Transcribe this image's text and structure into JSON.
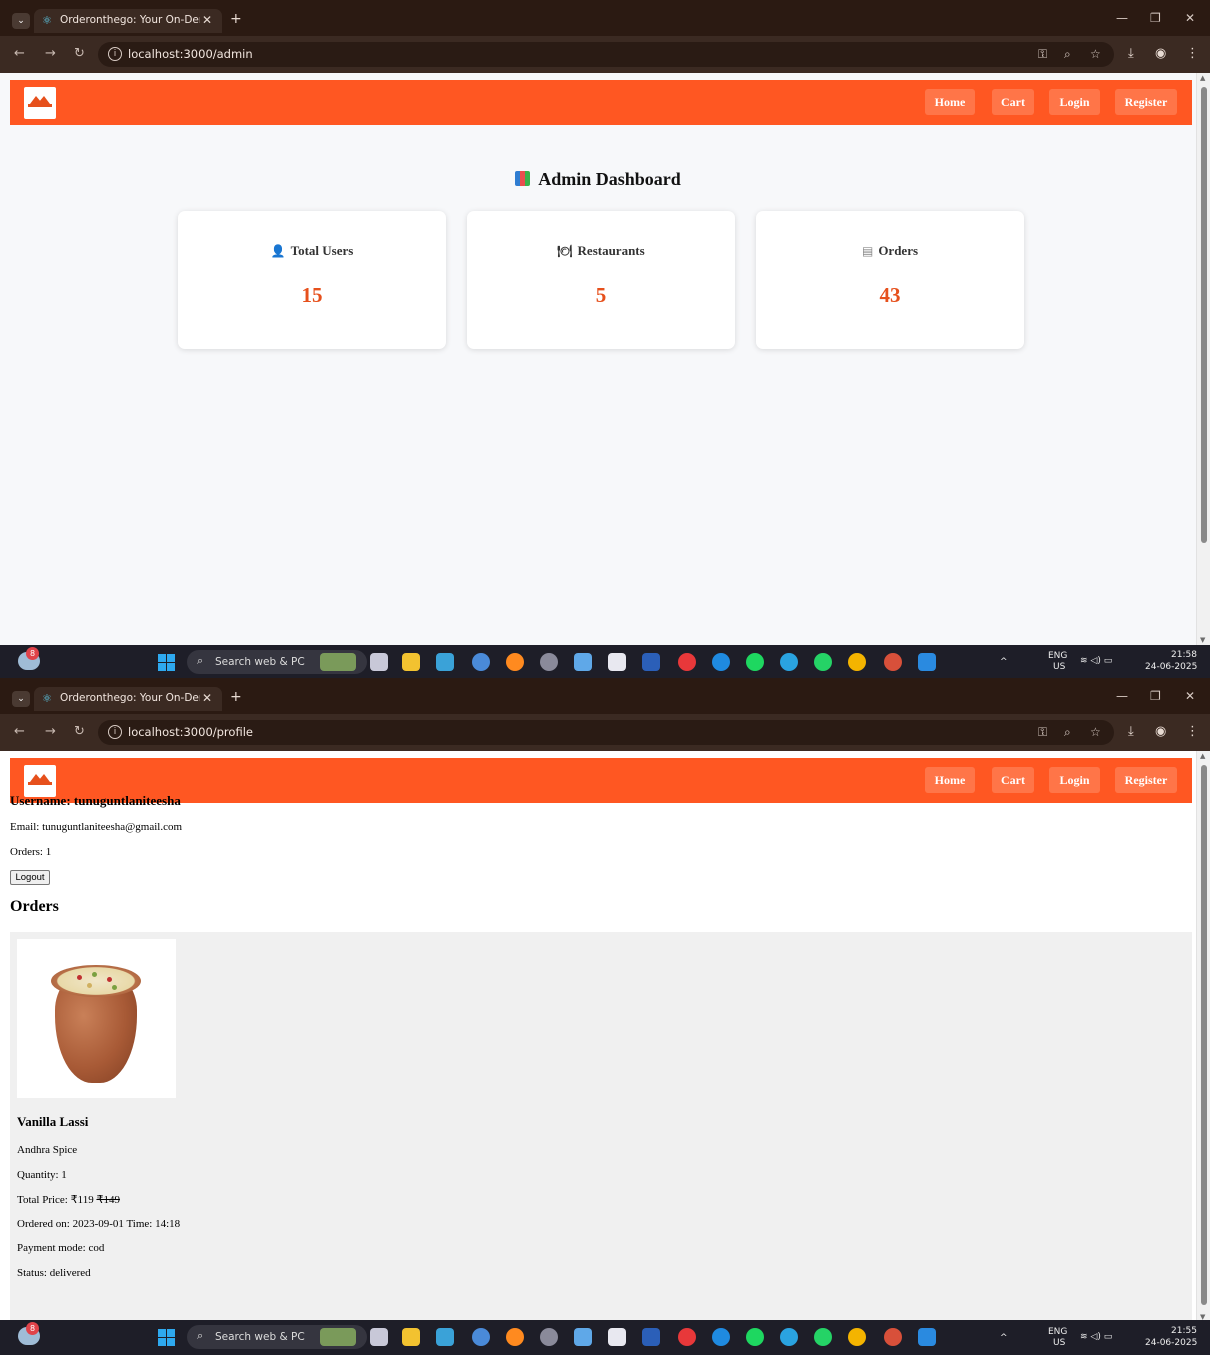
{
  "browser": {
    "tab_title": "Orderonthego: Your On-Deman",
    "tab_close": "✕",
    "new_tab": "+"
  },
  "screen1": {
    "url": "localhost:3000/admin",
    "nav": {
      "home": "Home",
      "cart": "Cart",
      "login": "Login",
      "register": "Register"
    },
    "dashboard": {
      "title": "Admin Dashboard",
      "cards": [
        {
          "label": "Total Users",
          "value": "15",
          "icon": "user-icon"
        },
        {
          "label": "Restaurants",
          "value": "5",
          "icon": "restaurant-icon"
        },
        {
          "label": "Orders",
          "value": "43",
          "icon": "orders-icon"
        }
      ]
    },
    "taskbar": {
      "search": "Search web & PC",
      "lang": "ENG",
      "region": "US",
      "time": "21:58",
      "date": "24-06-2025",
      "badge": "8"
    }
  },
  "screen2": {
    "url": "localhost:3000/profile",
    "nav": {
      "home": "Home",
      "cart": "Cart",
      "login": "Login",
      "register": "Register"
    },
    "profile": {
      "username": "Username: tunuguntlaniteesha",
      "email": "Email: tunuguntlaniteesha@gmail.com",
      "orders_count": "Orders: 1",
      "logout": "Logout",
      "orders_heading": "Orders"
    },
    "order": {
      "name": "Vanilla Lassi",
      "restaurant": "Andhra Spice",
      "quantity": "Quantity: 1",
      "price_prefix": "Total Price: ₹119",
      "price_original": "₹149",
      "ordered_on": "Ordered on: 2023-09-01 Time: 14:18",
      "payment": "Payment mode: cod",
      "status": "Status: delivered"
    },
    "taskbar": {
      "search": "Search web & PC",
      "lang": "ENG",
      "region": "US",
      "time": "21:55",
      "date": "24-06-2025",
      "badge": "8"
    }
  },
  "colors": {
    "brand": "#ff5722",
    "accent_value": "#e6501c",
    "chrome": "#3b2a22"
  }
}
